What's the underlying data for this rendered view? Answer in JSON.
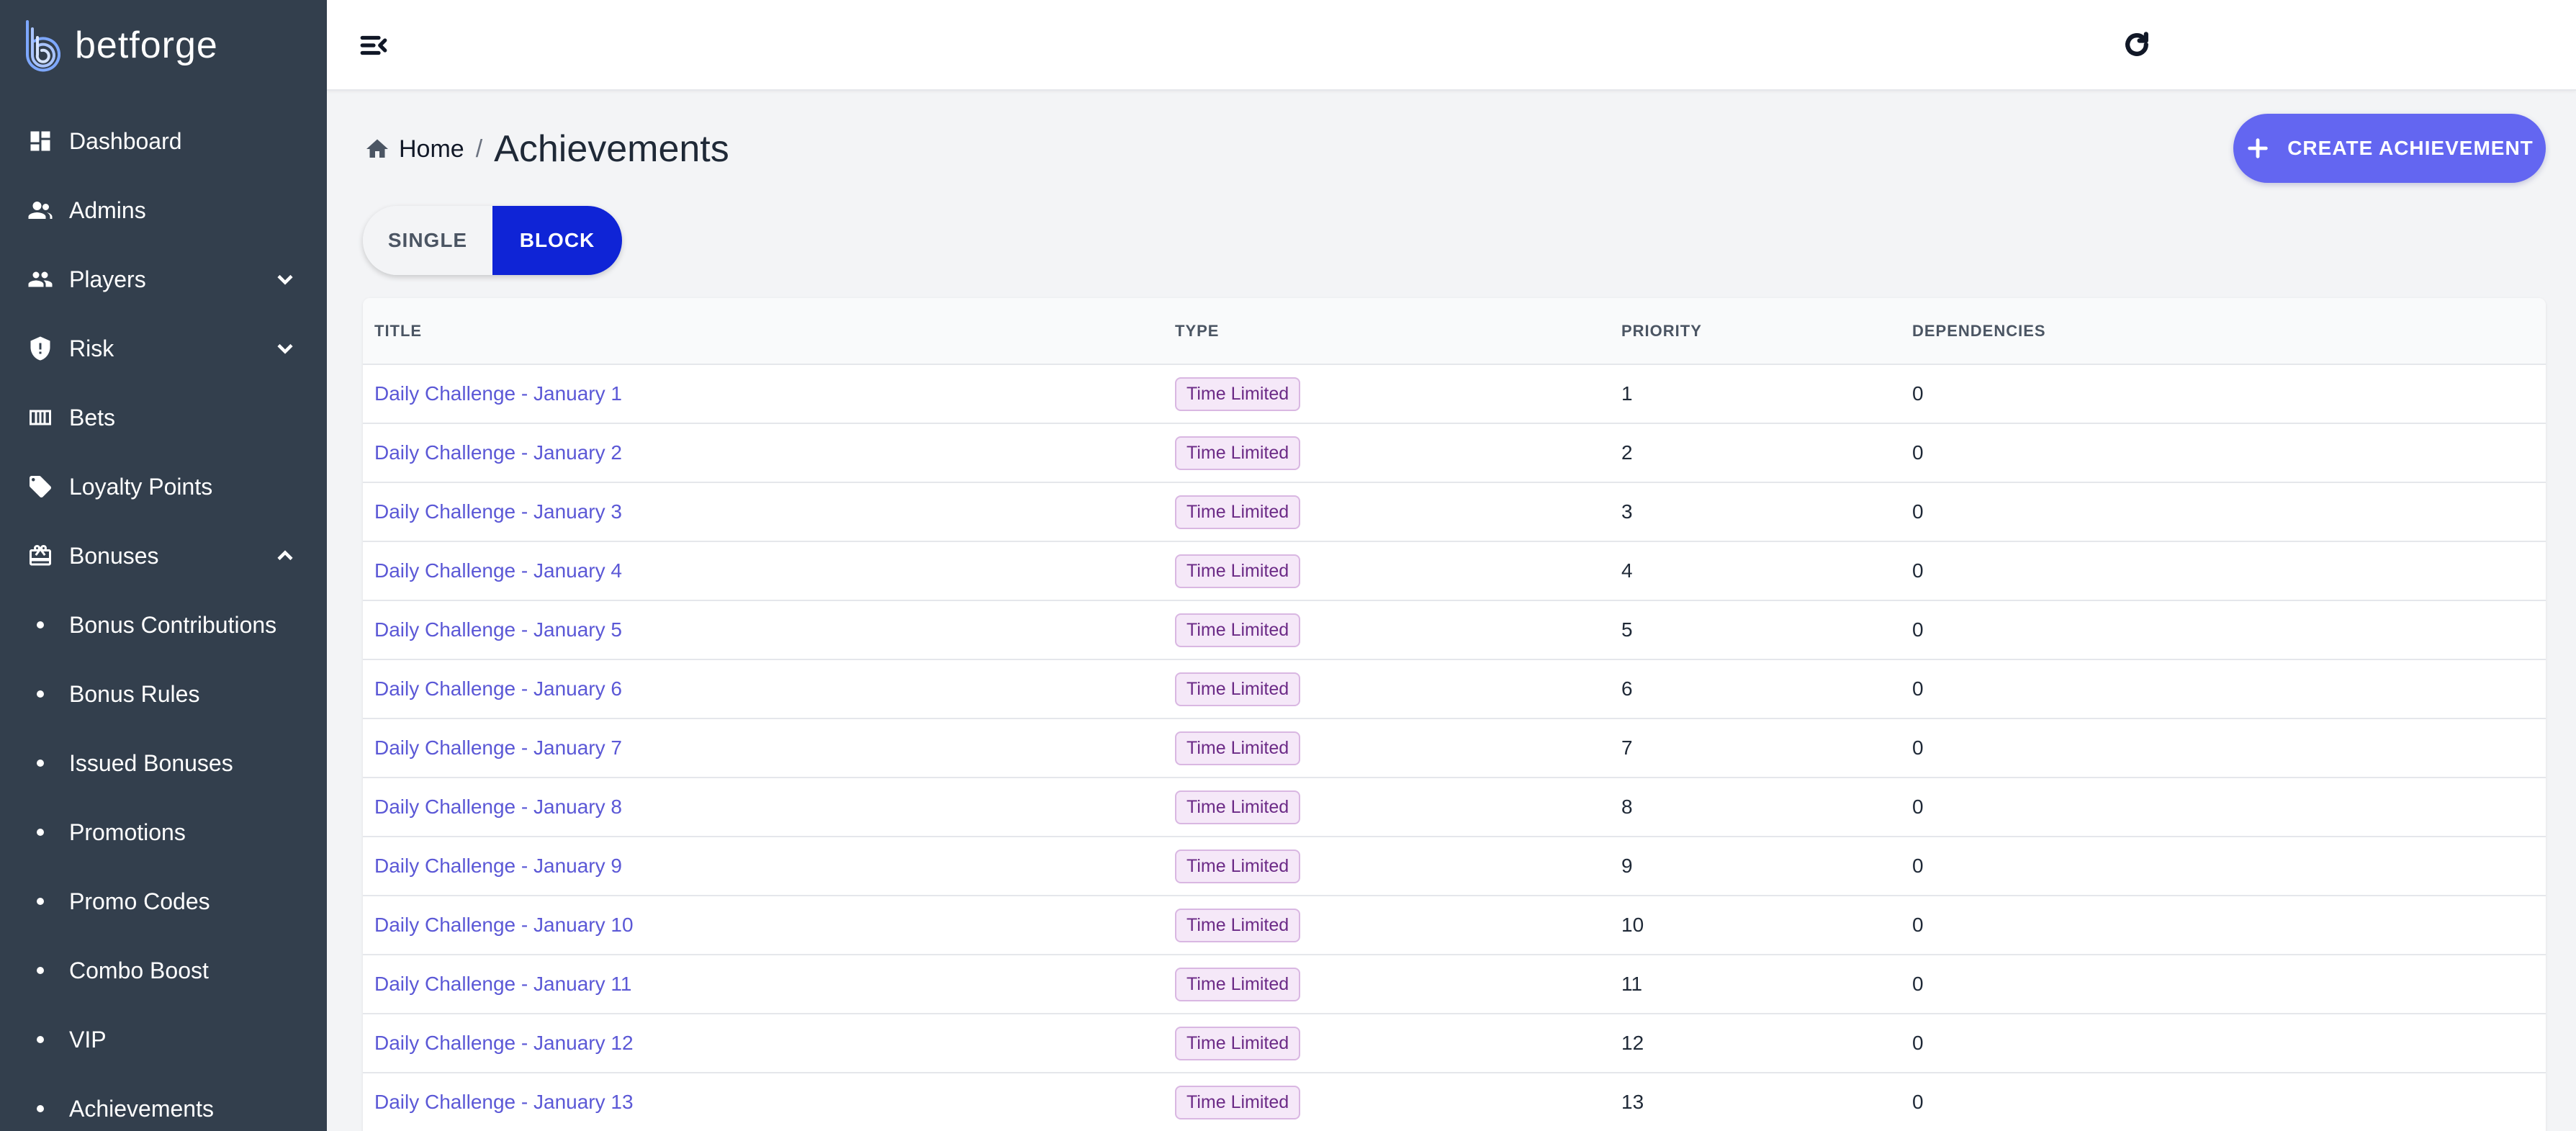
{
  "brand": {
    "name": "betforge"
  },
  "sidebar": {
    "items": [
      {
        "label": "Dashboard",
        "icon": "dashboard-icon"
      },
      {
        "label": "Admins",
        "icon": "admins-icon"
      },
      {
        "label": "Players",
        "icon": "players-icon",
        "chevron": "down"
      },
      {
        "label": "Risk",
        "icon": "shield-icon",
        "chevron": "down"
      },
      {
        "label": "Bets",
        "icon": "bets-icon"
      },
      {
        "label": "Loyalty Points",
        "icon": "tag-icon"
      },
      {
        "label": "Bonuses",
        "icon": "gift-icon",
        "chevron": "up",
        "expanded": true
      }
    ],
    "bonus_subitems": [
      "Bonus Contributions",
      "Bonus Rules",
      "Issued Bonuses",
      "Promotions",
      "Promo Codes",
      "Combo Boost",
      "VIP",
      "Achievements"
    ]
  },
  "topbar": {
    "menu_icon": "menu-collapse-icon",
    "refresh_icon": "refresh-icon"
  },
  "breadcrumb": {
    "home": "Home",
    "separator": "/",
    "current": "Achievements"
  },
  "actions": {
    "create_label": "CREATE ACHIEVEMENT"
  },
  "mode_toggle": {
    "single": "SINGLE",
    "block": "BLOCK",
    "selected": "BLOCK"
  },
  "table": {
    "headers": [
      "TITLE",
      "TYPE",
      "PRIORITY",
      "DEPENDENCIES"
    ],
    "rows": [
      {
        "title": "Daily Challenge - January 1",
        "type": "Time Limited",
        "priority": "1",
        "dependencies": "0"
      },
      {
        "title": "Daily Challenge - January 2",
        "type": "Time Limited",
        "priority": "2",
        "dependencies": "0"
      },
      {
        "title": "Daily Challenge - January 3",
        "type": "Time Limited",
        "priority": "3",
        "dependencies": "0"
      },
      {
        "title": "Daily Challenge - January 4",
        "type": "Time Limited",
        "priority": "4",
        "dependencies": "0"
      },
      {
        "title": "Daily Challenge - January 5",
        "type": "Time Limited",
        "priority": "5",
        "dependencies": "0"
      },
      {
        "title": "Daily Challenge - January 6",
        "type": "Time Limited",
        "priority": "6",
        "dependencies": "0"
      },
      {
        "title": "Daily Challenge - January 7",
        "type": "Time Limited",
        "priority": "7",
        "dependencies": "0"
      },
      {
        "title": "Daily Challenge - January 8",
        "type": "Time Limited",
        "priority": "8",
        "dependencies": "0"
      },
      {
        "title": "Daily Challenge - January 9",
        "type": "Time Limited",
        "priority": "9",
        "dependencies": "0"
      },
      {
        "title": "Daily Challenge - January 10",
        "type": "Time Limited",
        "priority": "10",
        "dependencies": "0"
      },
      {
        "title": "Daily Challenge - January 11",
        "type": "Time Limited",
        "priority": "11",
        "dependencies": "0"
      },
      {
        "title": "Daily Challenge - January 12",
        "type": "Time Limited",
        "priority": "12",
        "dependencies": "0"
      },
      {
        "title": "Daily Challenge - January 13",
        "type": "Time Limited",
        "priority": "13",
        "dependencies": "0"
      }
    ]
  },
  "colors": {
    "sidebar_bg": "#333f4d",
    "accent": "#6366f1",
    "toggle_selected": "#0f24d6",
    "link": "#5b58d6",
    "badge_bg": "#f5e8f8",
    "badge_text": "#6b2a86"
  }
}
